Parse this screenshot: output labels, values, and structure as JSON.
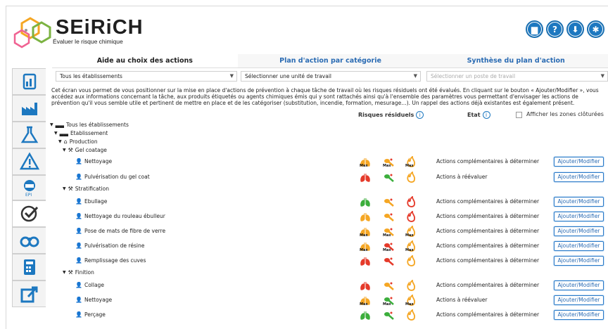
{
  "app": {
    "brand": "SEiRiCH",
    "tagline": "Évaluer le risque chimique"
  },
  "header_buttons": [
    {
      "icon": "folder-icon",
      "glyph": "▆"
    },
    {
      "icon": "help-icon",
      "glyph": "?"
    },
    {
      "icon": "download-icon",
      "glyph": "⬇"
    },
    {
      "icon": "settings-icon",
      "glyph": "✱"
    }
  ],
  "sidebar": [
    "dashboard-icon",
    "factory-icon",
    "flask-icon",
    "warning-icon",
    "epi-icon",
    "check-icon",
    "binoculars-icon",
    "calculator-icon",
    "export-icon"
  ],
  "tabs": [
    {
      "label": "Aide au choix des actions",
      "active": true
    },
    {
      "label": "Plan d'action par catégorie",
      "active": false
    },
    {
      "label": "Synthèse du plan d'action",
      "active": false
    }
  ],
  "selects": {
    "etablissement": "Tous les établissements",
    "unite": "Sélectionner une unité de travail",
    "poste": "Sélectionner un poste de travail"
  },
  "intro": "Cet écran vous permet de vous positionner sur la mise en place d'actions de prévention à chaque tâche de travail où les risques résiduels ont été évalués. En cliquant sur le bouton « Ajouter/Modifier », vous accédez aux informations concernant la tâche, aux produits étiquetés ou agents chimiques émis qui y sont rattachés ainsi qu'à l'ensemble des paramètres vous permettant d'envisager les actions de prévention qu'il vous semble utile et pertinent de mettre en place et de les catégoriser (substitution, incendie, formation, mesurage…). Un rappel des actions déjà existantes est également présent.",
  "columns": {
    "risques": "Risques résiduels",
    "etat": "Etat",
    "closed": "Afficher les zones clôturées"
  },
  "tree": {
    "root": "Tous les établissements",
    "etab": "Etablissement",
    "groups": [
      {
        "name": "Production",
        "icon": "home-icon"
      },
      {
        "name": "Gel coatage",
        "icon": "tools-icon"
      },
      {
        "name": "Stratification",
        "icon": "tools-icon"
      },
      {
        "name": "Finition",
        "icon": "tools-icon"
      }
    ]
  },
  "max_label": "Max",
  "button_label": "Ajouter/Modifier",
  "colors": {
    "red": "#e53a2a",
    "orange": "#f5a623",
    "green": "#3cae3c",
    "blue": "#1d78c0"
  },
  "tasks": [
    {
      "name": "Nettoyage",
      "etat": "Actions complémentaires à déterminer",
      "r": [
        "orange-max",
        "orange-max",
        "orange-max"
      ]
    },
    {
      "name": "Pulvérisation du gel coat",
      "etat": "Actions à réévaluer",
      "r": [
        "red",
        "green",
        "orange"
      ]
    },
    {
      "name": "Ebullage",
      "etat": "Actions complémentaires à déterminer",
      "r": [
        "green",
        "orange",
        "red"
      ]
    },
    {
      "name": "Nettoyage du rouleau ébulleur",
      "etat": "Actions complémentaires à déterminer",
      "r": [
        "orange",
        "orange",
        "red"
      ]
    },
    {
      "name": "Pose de mats de fibre de verre",
      "etat": "Actions complémentaires à déterminer",
      "r": [
        "orange-max",
        "orange-max",
        "orange-max"
      ]
    },
    {
      "name": "Pulvérisation de résine",
      "etat": "Actions complémentaires à déterminer",
      "r": [
        "orange-max",
        "red-max",
        "orange-max"
      ]
    },
    {
      "name": "Remplissage des cuves",
      "etat": "Actions complémentaires à déterminer",
      "r": [
        "red",
        "red",
        "orange"
      ]
    },
    {
      "name": "Collage",
      "etat": "Actions complémentaires à déterminer",
      "r": [
        "red",
        "orange",
        "orange"
      ]
    },
    {
      "name": "Nettoyage",
      "etat": "Actions à réévaluer",
      "r": [
        "orange-max",
        "green-max",
        "orange-max"
      ]
    },
    {
      "name": "Perçage",
      "etat": "Actions complémentaires à déterminer",
      "r": [
        "green",
        "green",
        "orange"
      ]
    }
  ]
}
